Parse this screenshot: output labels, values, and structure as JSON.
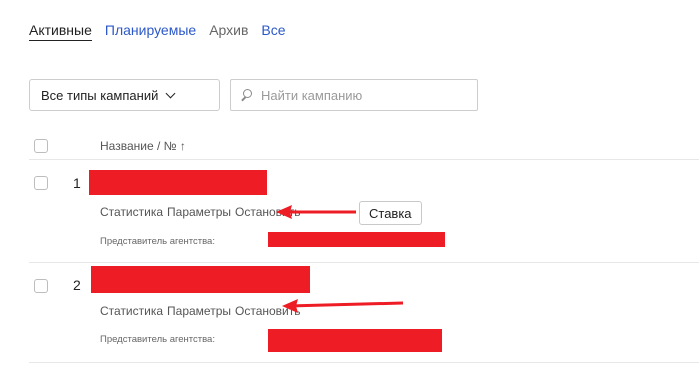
{
  "tabs": {
    "active": "Активные",
    "planned": "Планируемые",
    "archive": "Архив",
    "all": "Все"
  },
  "filters": {
    "campaign_types": "Все типы кампаний",
    "search_placeholder": "Найти кампанию"
  },
  "table": {
    "header_name": "Название / № ↑",
    "rows": [
      {
        "number": "1",
        "actions": [
          "Статистика",
          "Параметры",
          "Остановить"
        ],
        "rate_button": "Ставка",
        "agent_label": "Представитель агентства:"
      },
      {
        "number": "2",
        "actions": [
          "Статистика",
          "Параметры",
          "Остановить"
        ],
        "agent_label": "Представитель агентства:"
      }
    ]
  },
  "colors": {
    "redaction": "#ee1c24",
    "link": "#2b58c9"
  }
}
